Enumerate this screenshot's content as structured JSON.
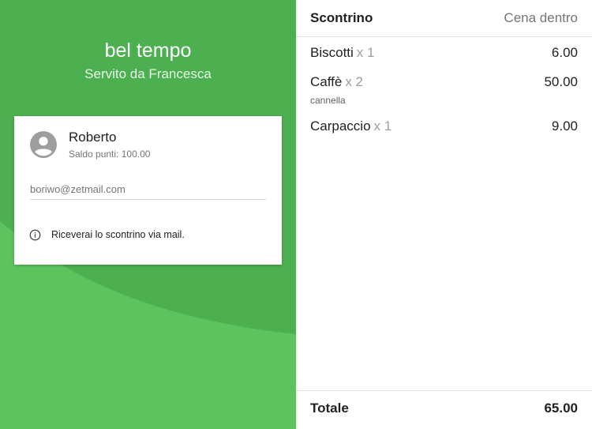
{
  "store": {
    "name": "bel tempo",
    "served_by": "Servito da Francesca"
  },
  "customer": {
    "name": "Roberto",
    "points": "Saldo punti: 100.00",
    "email": "boriwo@zetmail.com",
    "info": "Riceverai lo scontrino via mail."
  },
  "receipt": {
    "title": "Scontrino",
    "mode": "Cena dentro",
    "items": [
      {
        "name": "Biscotti",
        "qty": "x 1",
        "price": "6.00",
        "note": ""
      },
      {
        "name": "Caffè",
        "qty": "x 2",
        "price": "50.00",
        "note": "cannella"
      },
      {
        "name": "Carpaccio",
        "qty": "x 1",
        "price": "9.00",
        "note": ""
      }
    ],
    "total_label": "Totale",
    "total_value": "65.00"
  },
  "colors": {
    "brand_green": "#4caf50",
    "wave_green": "#5cc35f"
  },
  "icons": [
    "account-circle-icon",
    "info-icon"
  ]
}
